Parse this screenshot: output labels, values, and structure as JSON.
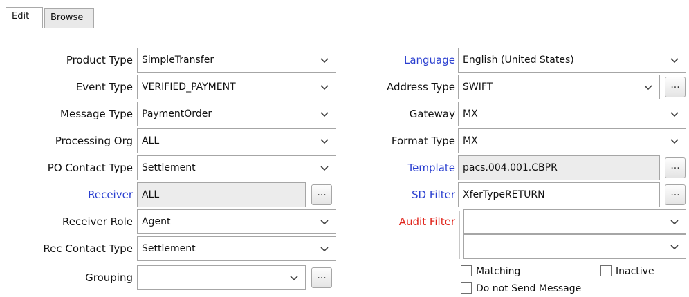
{
  "tabs": [
    {
      "label": "Edit",
      "active": true
    },
    {
      "label": "Browse",
      "active": false
    }
  ],
  "left_fields": {
    "product_type": {
      "label": "Product Type",
      "value": "SimpleTransfer"
    },
    "event_type": {
      "label": "Event Type",
      "value": "VERIFIED_PAYMENT"
    },
    "message_type": {
      "label": "Message Type",
      "value": "PaymentOrder"
    },
    "processing_org": {
      "label": "Processing Org",
      "value": "ALL"
    },
    "po_contact_type": {
      "label": "PO Contact Type",
      "value": "Settlement"
    },
    "receiver": {
      "label": "Receiver",
      "value": "ALL",
      "button": "..."
    },
    "receiver_role": {
      "label": "Receiver Role",
      "value": "Agent"
    },
    "rec_contact_type": {
      "label": "Rec Contact Type",
      "value": "Settlement"
    },
    "grouping": {
      "label": "Grouping",
      "value": "",
      "button": "..."
    }
  },
  "right_fields": {
    "language": {
      "label": "Language",
      "value": "English (United States)"
    },
    "address_type": {
      "label": "Address Type",
      "value": "SWIFT",
      "button": "..."
    },
    "gateway": {
      "label": "Gateway",
      "value": "MX"
    },
    "format_type": {
      "label": "Format Type",
      "value": "MX"
    },
    "template": {
      "label": "Template",
      "value": "pacs.004.001.CBPR",
      "button": "..."
    },
    "sd_filter": {
      "label": "SD Filter",
      "value": "XferTypeRETURN",
      "button": "..."
    },
    "audit_filter": {
      "label": "Audit Filter",
      "value1": "",
      "value2": ""
    }
  },
  "checkboxes": {
    "matching": {
      "label": "Matching",
      "checked": false
    },
    "inactive": {
      "label": "Inactive",
      "checked": false
    },
    "do_not_send": {
      "label": "Do not Send Message",
      "checked": false
    }
  },
  "colors": {
    "link_label": "#2a3fd0",
    "required_label": "#e0241b",
    "readonly_bg": "#ececec"
  },
  "icons": {
    "dropdown": "chevron-down-icon",
    "browse": "ellipsis-button"
  }
}
